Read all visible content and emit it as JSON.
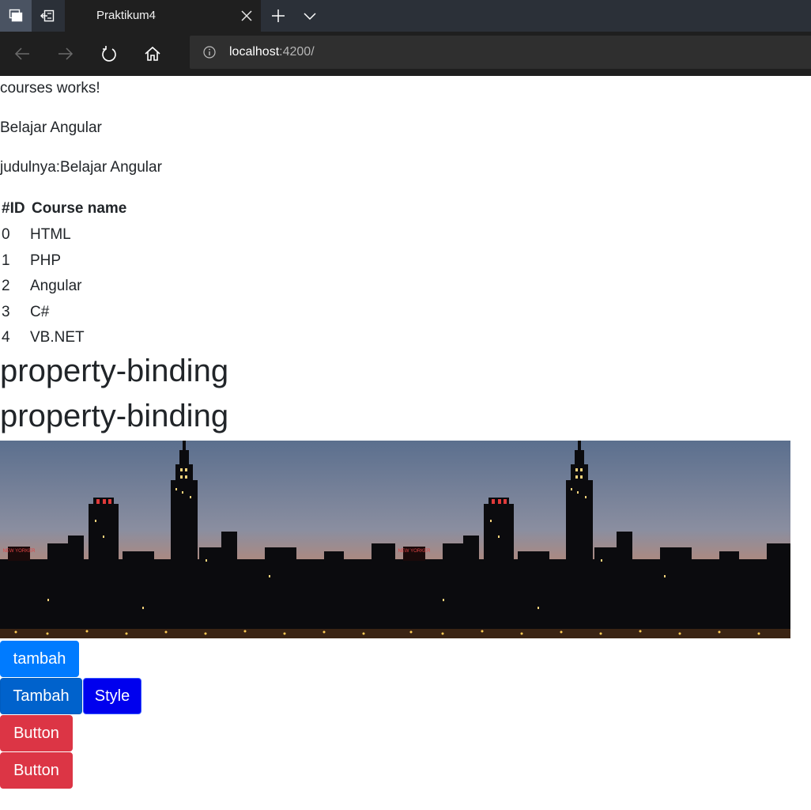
{
  "browser": {
    "tab_title": "Praktikum4",
    "url_host": "localhost",
    "url_rest": ":4200/",
    "icons": [
      "tab-stack-icon",
      "tabs-aside-icon",
      "close-icon",
      "plus-icon",
      "chevron-down-icon",
      "back-arrow-icon",
      "forward-arrow-icon",
      "refresh-icon",
      "home-icon",
      "info-icon"
    ]
  },
  "content": {
    "line1": "courses works!",
    "line2": "Belajar Angular",
    "line3": "judulnya:Belajar Angular",
    "table": {
      "headers": [
        "#ID",
        "Course name"
      ],
      "rows": [
        {
          "id": "0",
          "name": "HTML"
        },
        {
          "id": "1",
          "name": "PHP"
        },
        {
          "id": "2",
          "name": "Angular"
        },
        {
          "id": "3",
          "name": "C#"
        },
        {
          "id": "4",
          "name": "VB.NET"
        }
      ]
    },
    "heading1": "property-binding",
    "heading2": "property-binding",
    "image_sign_text": "NEW YORKER",
    "buttons": {
      "tambah": "tambah",
      "tambah2": "Tambah",
      "style": "Style",
      "button1": "Button",
      "button2": "Button"
    }
  },
  "colors": {
    "primary": "#007bff",
    "primary_active": "#0062cc",
    "style_blue": "#0000ee",
    "danger": "#dc3545"
  }
}
